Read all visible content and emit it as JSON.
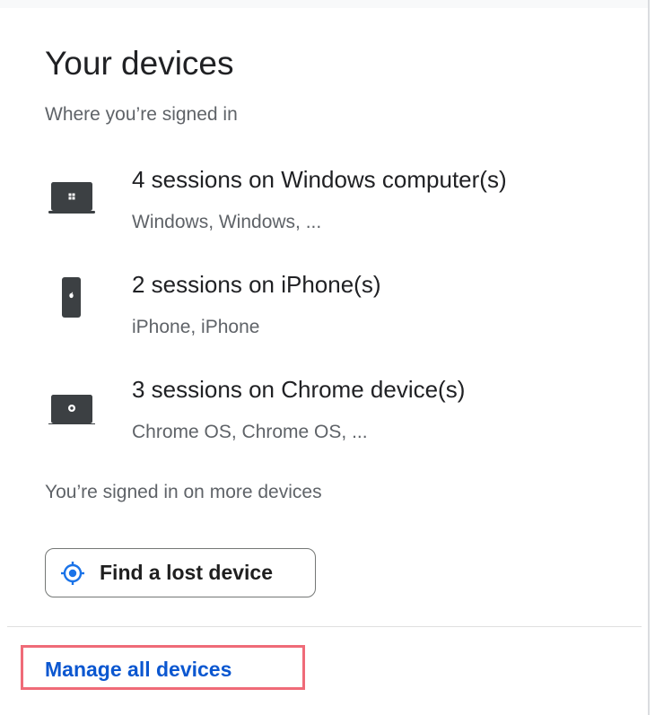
{
  "card": {
    "title": "Your devices",
    "subtitle": "Where you’re signed in",
    "devices": [
      {
        "icon": "windows-laptop-icon",
        "title": "4 sessions on Windows computer(s)",
        "details": "Windows, Windows, ..."
      },
      {
        "icon": "iphone-icon",
        "title": "2 sessions on iPhone(s)",
        "details": "iPhone, iPhone"
      },
      {
        "icon": "chromebook-icon",
        "title": "3 sessions on Chrome device(s)",
        "details": "Chrome OS, Chrome OS, ..."
      }
    ],
    "more_devices_text": "You’re signed in on more devices",
    "find_button": {
      "icon": "location-target-icon",
      "label": "Find a lost device"
    },
    "manage_link": "Manage all devices"
  },
  "colors": {
    "primary_text": "#202124",
    "secondary_text": "#5f6368",
    "link": "#0b57d0",
    "accent_blue": "#1a73e8",
    "highlight": "#ef6b78",
    "device_icon": "#3c4043"
  }
}
